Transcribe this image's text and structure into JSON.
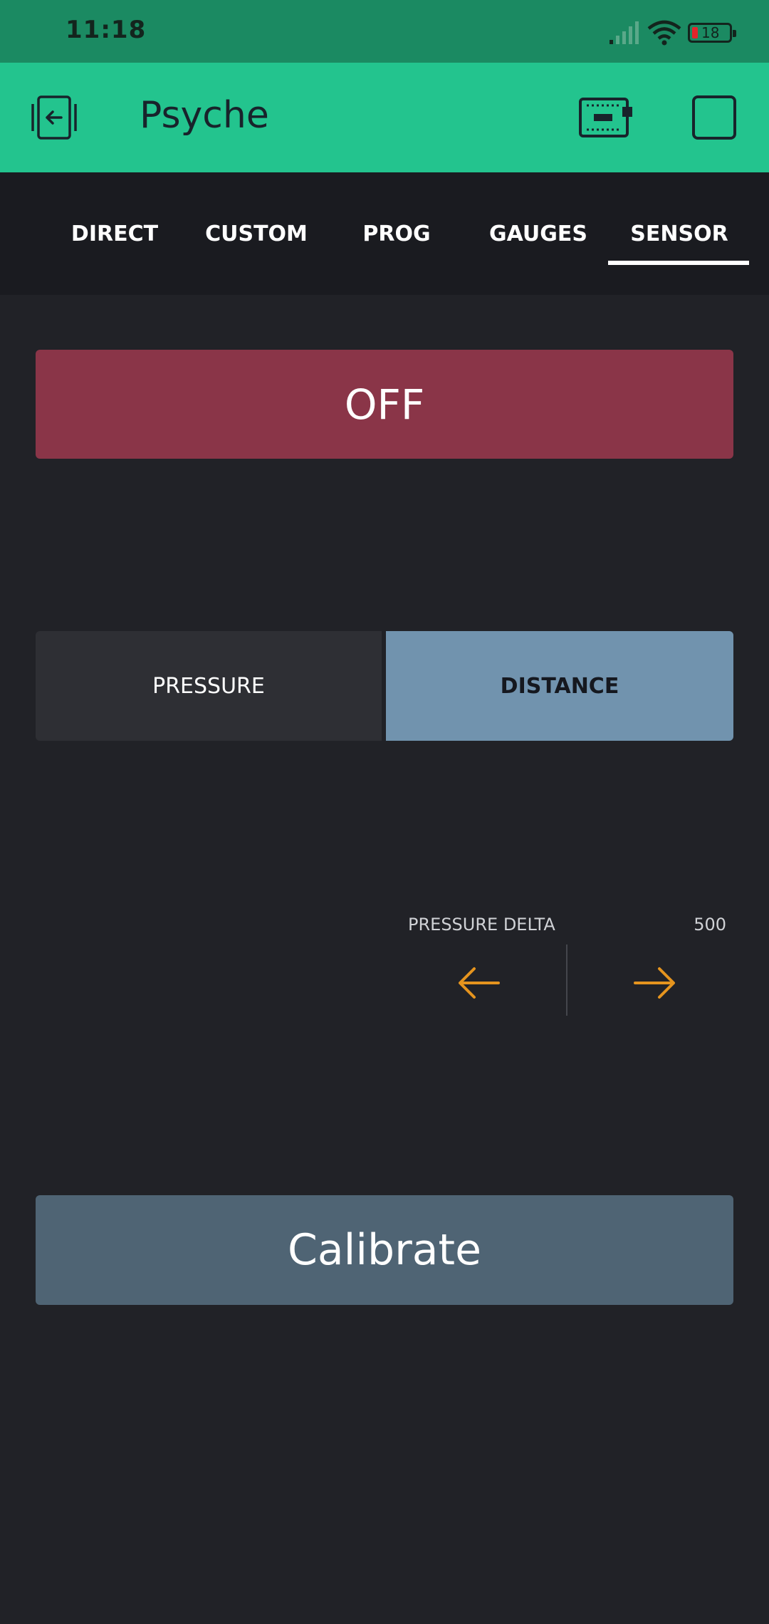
{
  "status_bar": {
    "time": "11:18",
    "battery_level": "18",
    "icons": [
      "signal-icon",
      "wifi-icon",
      "battery-icon"
    ]
  },
  "app_bar": {
    "title": "Psyche",
    "icons": [
      "back-icon",
      "device-icon",
      "square-icon"
    ]
  },
  "tabs": [
    {
      "label": "DIRECT",
      "active": false
    },
    {
      "label": "CUSTOM",
      "active": false
    },
    {
      "label": "PROG",
      "active": false
    },
    {
      "label": "GAUGES",
      "active": false
    },
    {
      "label": "SENSOR",
      "active": true
    }
  ],
  "main": {
    "power_button_label": "OFF",
    "mode_segments": [
      {
        "label": "PRESSURE",
        "selected": false
      },
      {
        "label": "DISTANCE",
        "selected": true
      }
    ],
    "pressure_delta": {
      "label": "PRESSURE DELTA",
      "value": "500"
    },
    "calibrate_label": "Calibrate"
  },
  "colors": {
    "status_bar": "#1b8a62",
    "app_bar": "#23c48e",
    "tab_bar": "#1a1b20",
    "background": "#212227",
    "off_button": "#8a3548",
    "segment_selected": "#7193ae",
    "segment_unselected": "#2e2f34",
    "arrow": "#e5941e",
    "calibrate_button": "#4f6474"
  }
}
